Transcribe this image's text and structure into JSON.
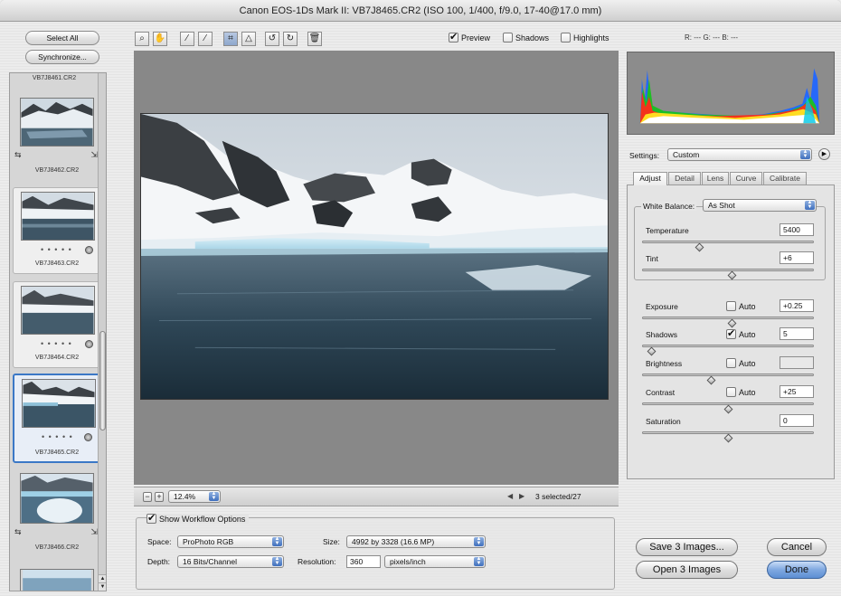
{
  "window": {
    "title": "Canon EOS-1Ds Mark II:  VB7J8465.CR2  (ISO 100, 1/400, f/9.0, 17-40@17.0 mm)"
  },
  "filmstrip": {
    "select_all": "Select All",
    "synchronize": "Synchronize...",
    "partial_name": "VB7J8461.CR2",
    "items": [
      {
        "name": "VB7J8462.CR2",
        "stars": ""
      },
      {
        "name": "VB7J8463.CR2",
        "stars": "• • • • •"
      },
      {
        "name": "VB7J8464.CR2",
        "stars": "• • • • •"
      },
      {
        "name": "VB7J8465.CR2",
        "stars": "• • • • •"
      },
      {
        "name": "VB7J8466.CR2",
        "stars": ""
      }
    ]
  },
  "toolbar": {
    "tools": [
      "zoom-icon",
      "hand-icon",
      "white-balance-icon",
      "color-sampler-icon",
      "crop-icon",
      "straighten-icon",
      "rotate-left-icon",
      "rotate-right-icon",
      "trash-icon"
    ],
    "preview_label": "Preview",
    "shadows_label": "Shadows",
    "highlights_label": "Highlights",
    "preview_checked": true,
    "shadows_checked": false,
    "highlights_checked": false,
    "rgb_readout": "R: ---   G: ---   B: ---"
  },
  "zoom": {
    "value": "12.4%",
    "selection": "3 selected/27"
  },
  "workflow": {
    "show_label": "Show Workflow Options",
    "space_label": "Space:",
    "space_value": "ProPhoto RGB",
    "depth_label": "Depth:",
    "depth_value": "16 Bits/Channel",
    "size_label": "Size:",
    "size_value": "4992 by 3328  (16.6 MP)",
    "resolution_label": "Resolution:",
    "resolution_value": "360",
    "resolution_unit": "pixels/inch"
  },
  "settings": {
    "label": "Settings:",
    "value": "Custom",
    "tabs": [
      "Adjust",
      "Detail",
      "Lens",
      "Curve",
      "Calibrate"
    ],
    "white_balance_label": "White Balance:",
    "white_balance_value": "As Shot",
    "auto_label": "Auto",
    "sliders": [
      {
        "label": "Temperature",
        "value": "5400",
        "level": 0.33
      },
      {
        "label": "Tint",
        "value": "+6",
        "level": 0.52
      },
      {
        "label": "Exposure",
        "value": "+0.25",
        "level": 0.52,
        "auto": false
      },
      {
        "label": "Shadows",
        "value": "5",
        "level": 0.05,
        "auto": true
      },
      {
        "label": "Brightness",
        "value": "",
        "level": 0.4,
        "auto": false
      },
      {
        "label": "Contrast",
        "value": "+25",
        "level": 0.5,
        "auto": false
      },
      {
        "label": "Saturation",
        "value": "0",
        "level": 0.5
      }
    ]
  },
  "buttons": {
    "save": "Save 3 Images...",
    "open": "Open 3 Images",
    "cancel": "Cancel",
    "done": "Done"
  },
  "colors": {
    "accent": "#5d8fd4",
    "selection_border": "#3b78c6"
  }
}
